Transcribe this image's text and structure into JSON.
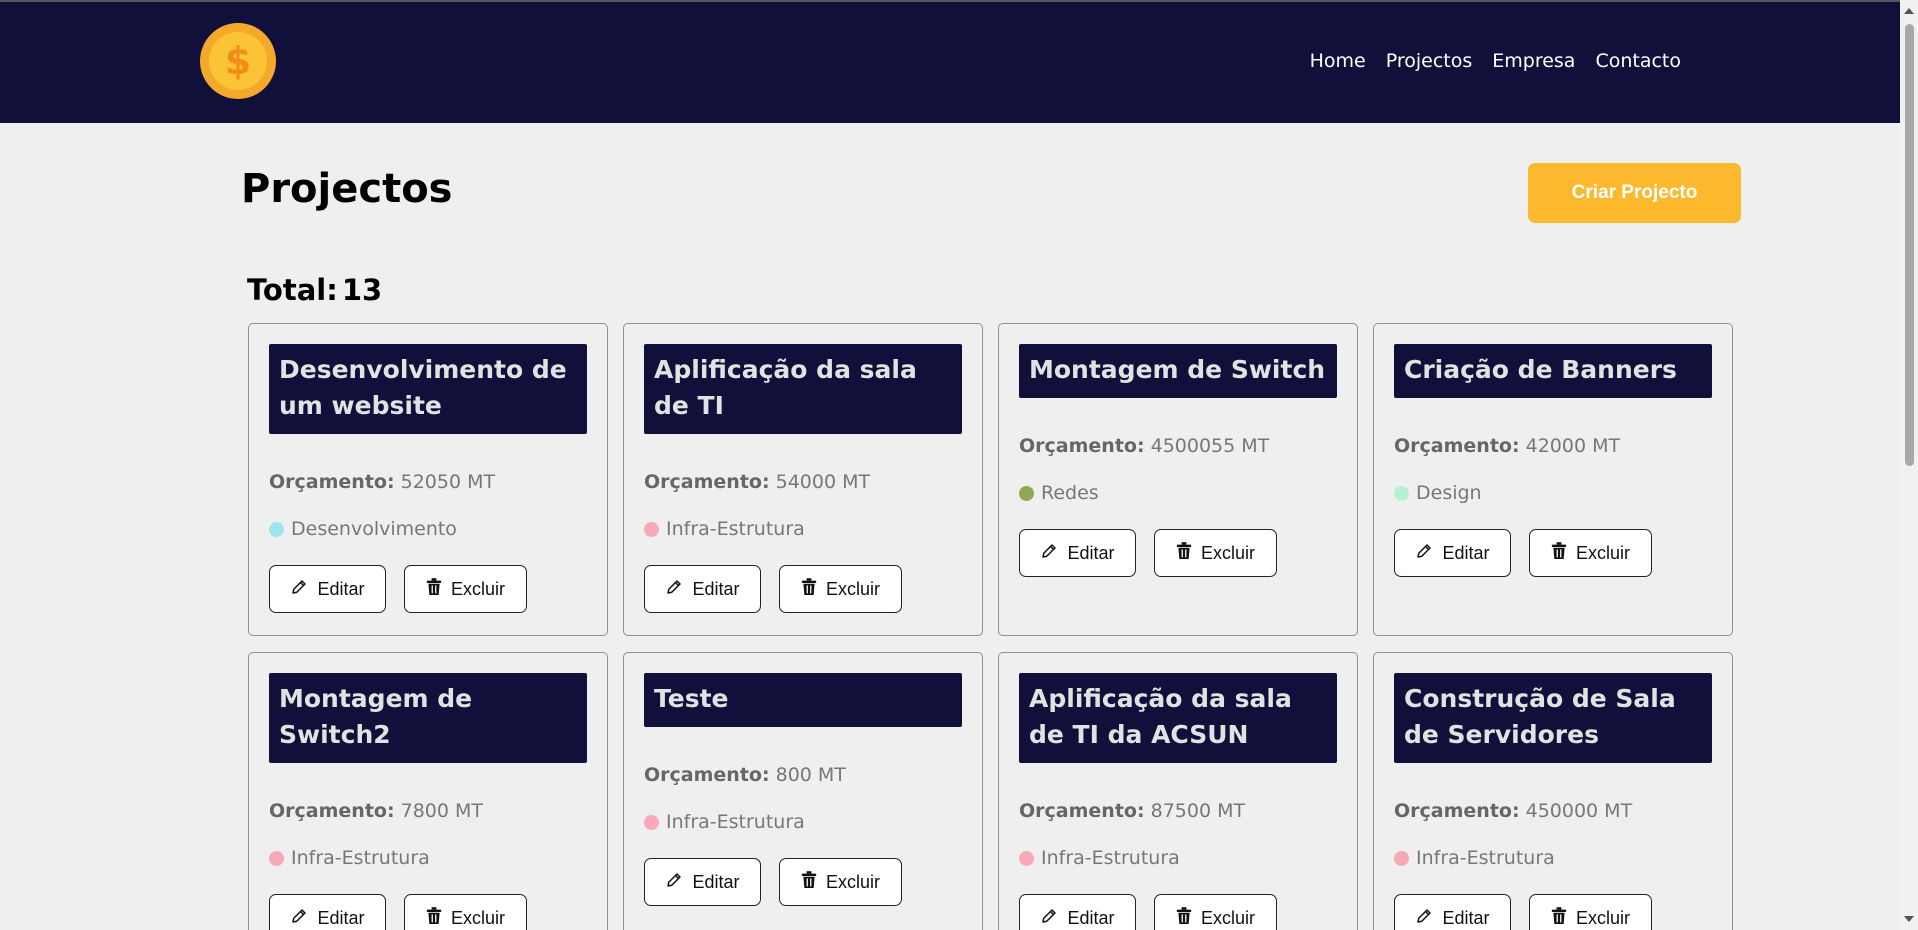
{
  "nav": {
    "links": [
      "Home",
      "Projectos",
      "Empresa",
      "Contacto"
    ]
  },
  "header": {
    "title": "Projectos",
    "create_label": "Criar Projecto"
  },
  "summary": {
    "total_label": "Total:",
    "total_value": "13"
  },
  "labels": {
    "budget": "Orçamento:",
    "edit": "Editar",
    "delete": "Excluir"
  },
  "projects": [
    {
      "title": "Desenvolvimento de um website",
      "budget": "52050 MT",
      "category": "Desenvolvimento",
      "color": "#9ee4ec"
    },
    {
      "title": "Aplificação da sala de TI",
      "budget": "54000 MT",
      "category": "Infra-Estrutura",
      "color": "#f7a9b8"
    },
    {
      "title": "Montagem de Switch",
      "budget": "4500055 MT",
      "category": "Redes",
      "color": "#8fa855"
    },
    {
      "title": "Criação de Banners",
      "budget": "42000 MT",
      "category": "Design",
      "color": "#b3f3cf"
    },
    {
      "title": "Montagem de Switch2",
      "budget": "7800 MT",
      "category": "Infra-Estrutura",
      "color": "#f7a9b8"
    },
    {
      "title": "Teste",
      "budget": "800 MT",
      "category": "Infra-Estrutura",
      "color": "#f7a9b8"
    },
    {
      "title": "Aplificação da sala de TI da ACSUN",
      "budget": "87500 MT",
      "category": "Infra-Estrutura",
      "color": "#f7a9b8"
    },
    {
      "title": "Construção de Sala de Servidores",
      "budget": "450000 MT",
      "category": "Infra-Estrutura",
      "color": "#f7a9b8"
    }
  ],
  "colors": {
    "navbar": "#11103a",
    "accent": "#fcb92d",
    "background": "#efefef"
  }
}
